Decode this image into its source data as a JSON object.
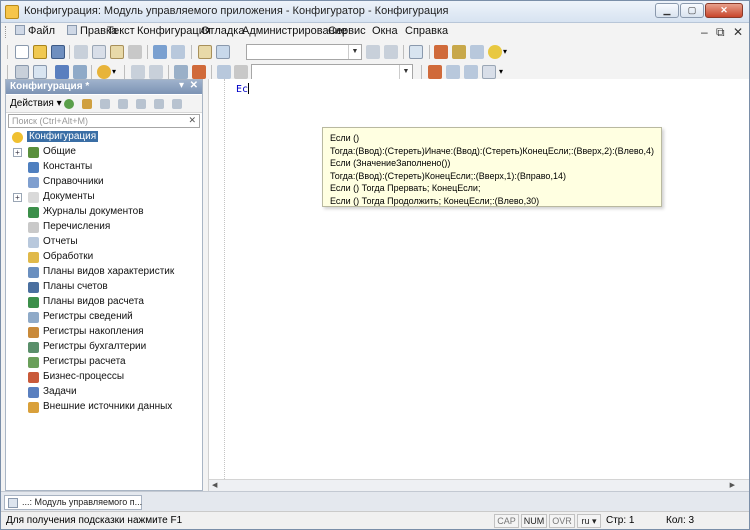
{
  "window": {
    "title": "Конфигурация: Модуль управляемого приложения - Конфигуратор - Конфигурация"
  },
  "menu": {
    "items": [
      "Файл",
      "Правка",
      "Текст",
      "Конфигурация",
      "Отладка",
      "Администрирование",
      "Сервис",
      "Окна",
      "Справка"
    ]
  },
  "config_panel": {
    "title": "Конфигурация *",
    "actions_label": "Действия ▾",
    "search_placeholder": "Поиск (Ctrl+Alt+M)",
    "root_label": "Конфигурация",
    "items": [
      {
        "label": "Общие",
        "expandable": true,
        "icon": "common-icon",
        "color": "#5a8f3c"
      },
      {
        "label": "Константы",
        "expandable": false,
        "icon": "constants-icon",
        "color": "#4f7fbf"
      },
      {
        "label": "Справочники",
        "expandable": false,
        "icon": "catalogs-icon",
        "color": "#7f9fcf"
      },
      {
        "label": "Документы",
        "expandable": true,
        "icon": "documents-icon",
        "color": "#d9d9d9"
      },
      {
        "label": "Журналы документов",
        "expandable": false,
        "icon": "journals-icon",
        "color": "#3c8f4a"
      },
      {
        "label": "Перечисления",
        "expandable": false,
        "icon": "enums-icon",
        "color": "#c9c9c9"
      },
      {
        "label": "Отчеты",
        "expandable": false,
        "icon": "reports-icon",
        "color": "#b8c8dc"
      },
      {
        "label": "Обработки",
        "expandable": false,
        "icon": "processing-icon",
        "color": "#e0b94a"
      },
      {
        "label": "Планы видов характеристик",
        "expandable": false,
        "icon": "char-types-icon",
        "color": "#6a8fbf"
      },
      {
        "label": "Планы счетов",
        "expandable": false,
        "icon": "accounts-chart-icon",
        "color": "#4a6f9f"
      },
      {
        "label": "Планы видов расчета",
        "expandable": false,
        "icon": "calc-types-icon",
        "color": "#3c8f4a"
      },
      {
        "label": "Регистры сведений",
        "expandable": false,
        "icon": "info-registers-icon",
        "color": "#8faac8"
      },
      {
        "label": "Регистры накопления",
        "expandable": false,
        "icon": "accum-registers-icon",
        "color": "#c98a3a"
      },
      {
        "label": "Регистры бухгалтерии",
        "expandable": false,
        "icon": "accounting-registers-icon",
        "color": "#5a8f6a"
      },
      {
        "label": "Регистры расчета",
        "expandable": false,
        "icon": "calc-registers-icon",
        "color": "#6a9f5a"
      },
      {
        "label": "Бизнес-процессы",
        "expandable": false,
        "icon": "business-process-icon",
        "color": "#c95a3a"
      },
      {
        "label": "Задачи",
        "expandable": false,
        "icon": "tasks-icon",
        "color": "#5a7fbf"
      },
      {
        "label": "Внешние источники данных",
        "expandable": false,
        "icon": "external-sources-icon",
        "color": "#d9a03a"
      }
    ]
  },
  "editor": {
    "code_text": "Ес",
    "hint_lines": [
      "Если ()",
      "Тогда:(Ввод):(Стереть)Иначе:(Ввод):(Стереть)КонецЕсли;:(Вверх,2):(Влево,4)",
      "Если (ЗначениеЗаполнено())",
      "Тогда:(Ввод):(Стереть)КонецЕсли;:(Вверх,1):(Вправо,14)",
      "Если () Тогда Прервать; КонецЕсли;",
      "Если () Тогда Продолжить; КонецЕсли;:(Влево,30)"
    ]
  },
  "taskbar": {
    "tab_label": "...: Модуль управляемого п..."
  },
  "status": {
    "hint": "Для получения подсказки нажмите F1",
    "cap": "CAP",
    "num": "NUM",
    "ovr": "OVR",
    "lang": "ru ▾",
    "line": "Стр: 1",
    "col": "Кол: 3"
  }
}
